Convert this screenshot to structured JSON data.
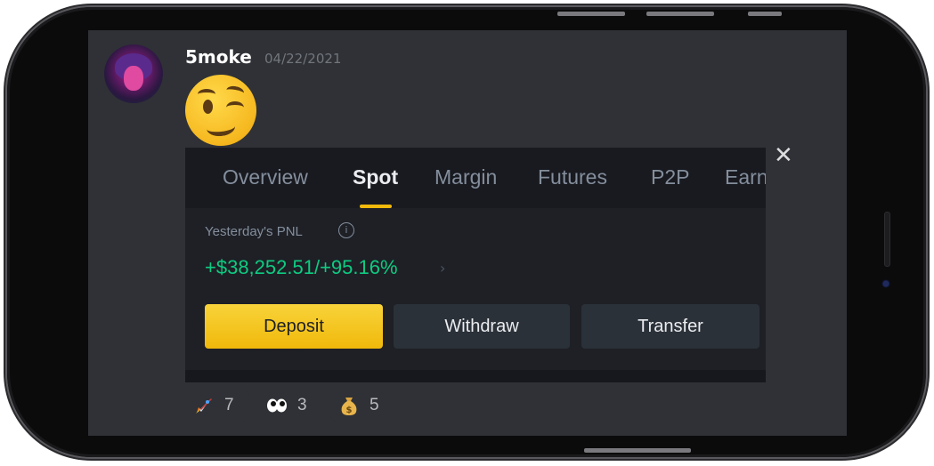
{
  "message": {
    "username": "5moke",
    "timestamp": "04/22/2021"
  },
  "embed": {
    "tabs": [
      {
        "label": "Overview",
        "active": false
      },
      {
        "label": "Spot",
        "active": true
      },
      {
        "label": "Margin",
        "active": false
      },
      {
        "label": "Futures",
        "active": false
      },
      {
        "label": "P2P",
        "active": false
      },
      {
        "label": "Earn",
        "active": false
      }
    ],
    "pnl_label": "Yesterday's PNL",
    "pnl_info_icon": "i",
    "pnl_value": "+$38,252.51/+95.16%",
    "pnl_chevron": "›",
    "buttons": {
      "deposit": "Deposit",
      "withdraw": "Withdraw",
      "transfer": "Transfer"
    },
    "close_symbol": "✕"
  },
  "reactions": [
    {
      "icon": "rocket-icon",
      "count": "7"
    },
    {
      "icon": "eyes-icon",
      "count": "3"
    },
    {
      "icon": "money-bag-icon",
      "count": "5"
    }
  ],
  "colors": {
    "accent_yellow": "#f0b90b",
    "profit_green": "#0ecb81",
    "discord_bg": "#2f3136"
  }
}
